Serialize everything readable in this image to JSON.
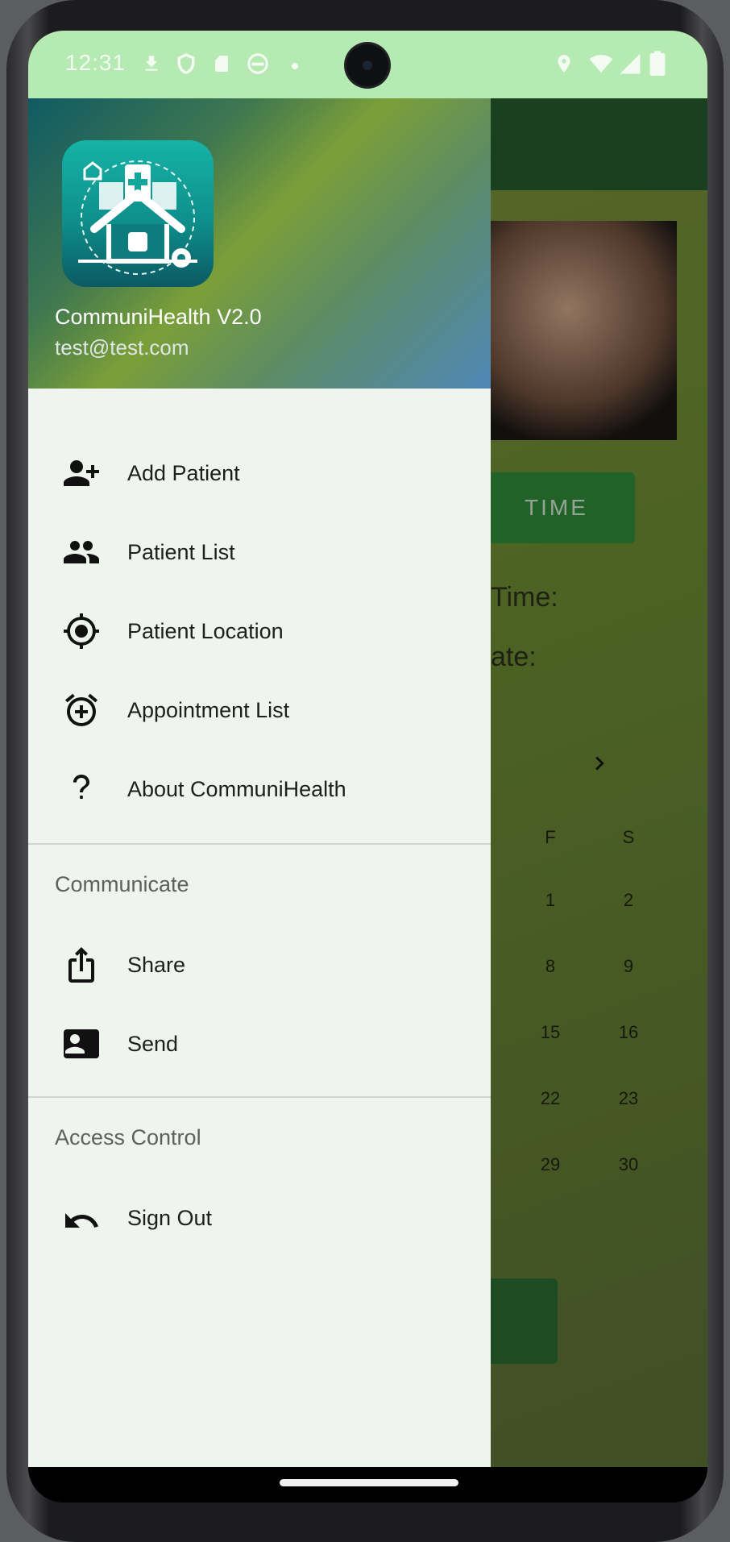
{
  "status_bar": {
    "time": "12:31"
  },
  "drawer": {
    "app_name": "CommuniHealth V2.0",
    "email": "test@test.com",
    "main_items": [
      {
        "label": "Add Patient",
        "icon": "add-person-icon"
      },
      {
        "label": "Patient List",
        "icon": "group-icon"
      },
      {
        "label": "Patient Location",
        "icon": "my-location-icon"
      },
      {
        "label": "Appointment List",
        "icon": "alarm-add-icon"
      },
      {
        "label": "About CommuniHealth",
        "icon": "question-mark-icon"
      }
    ],
    "communicate_title": "Communicate",
    "communicate_items": [
      {
        "label": "Share",
        "icon": "share-icon"
      },
      {
        "label": "Send",
        "icon": "contact-mail-icon"
      }
    ],
    "access_title": "Access Control",
    "access_items": [
      {
        "label": "Sign Out",
        "icon": "undo-icon"
      }
    ]
  },
  "background_screen": {
    "button_label": "TIME",
    "time_label_fragment": "Time:",
    "date_label_fragment": "ate:",
    "calendar_headers": [
      "F",
      "S"
    ],
    "calendar_rows": [
      [
        "1",
        "2"
      ],
      [
        "8",
        "9"
      ],
      [
        "15",
        "16"
      ],
      [
        "22",
        "23"
      ],
      [
        "29",
        "30"
      ]
    ]
  },
  "colors": {
    "status_bar": "#b5ebb2",
    "toolbar": "#255b2c",
    "drawer_bg": "#f0f4ef",
    "accent_button": "#2f8838"
  }
}
